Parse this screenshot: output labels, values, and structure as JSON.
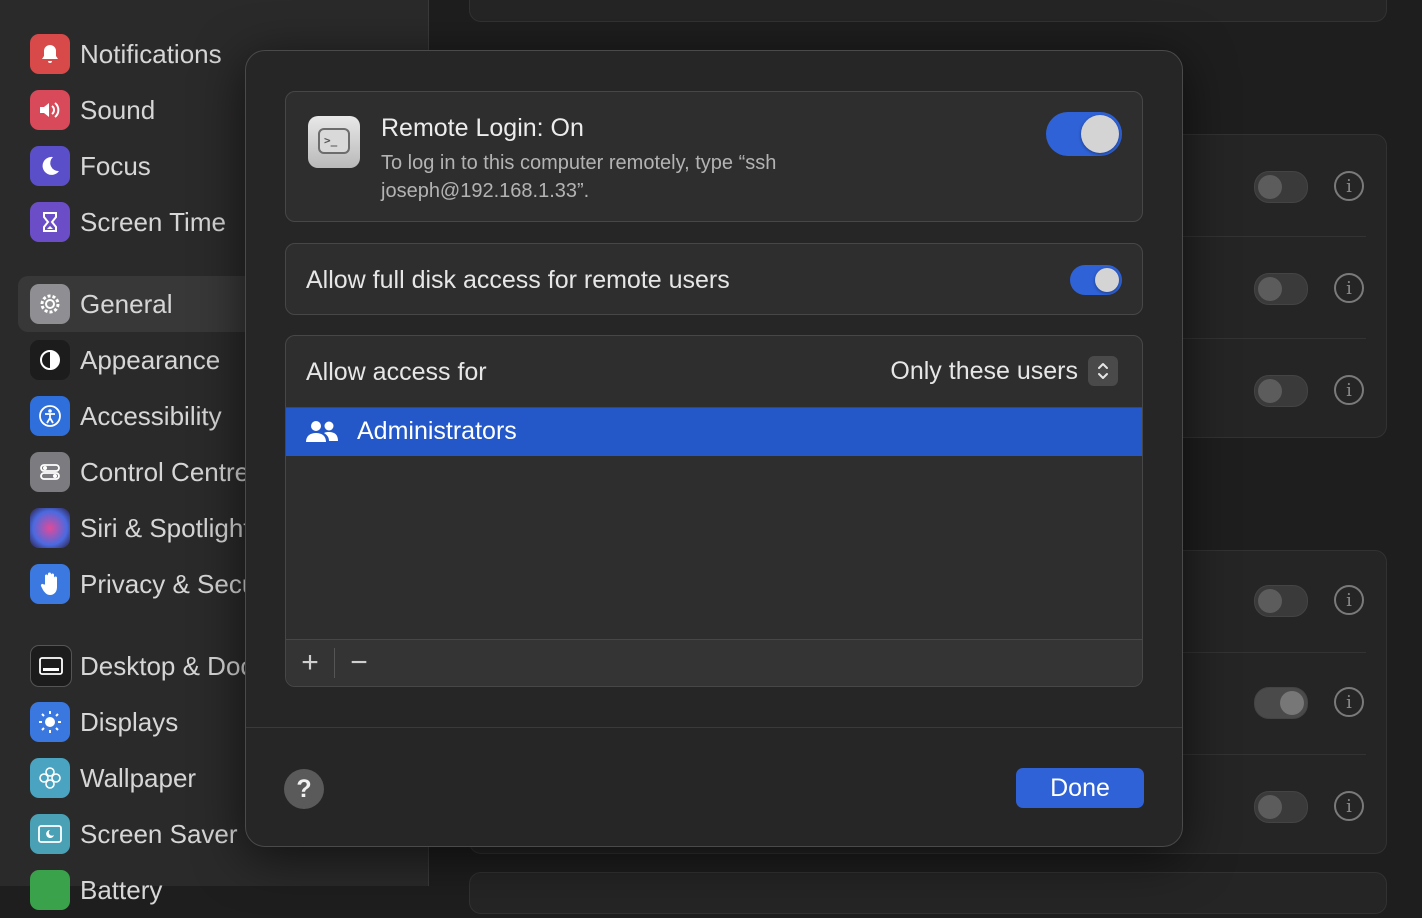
{
  "sidebar": {
    "items": [
      {
        "label": "Notifications",
        "icon": "bell-icon",
        "color": "#d84a4a"
      },
      {
        "label": "Sound",
        "icon": "speaker-icon",
        "color": "#d84a5a"
      },
      {
        "label": "Focus",
        "icon": "moon-icon",
        "color": "#5b4fc9"
      },
      {
        "label": "Screen Time",
        "icon": "hourglass-icon",
        "color": "#6b4ec7"
      },
      {
        "label": "General",
        "icon": "gear-icon",
        "color": "#8e8e93"
      },
      {
        "label": "Appearance",
        "icon": "appearance-icon",
        "color": "#1c1c1c"
      },
      {
        "label": "Accessibility",
        "icon": "accessibility-icon",
        "color": "#2f6fdc"
      },
      {
        "label": "Control Centre",
        "icon": "control-centre-icon",
        "color": "#7c7c80"
      },
      {
        "label": "Siri & Spotlight",
        "icon": "siri-icon",
        "color": "#3a2a55"
      },
      {
        "label": "Privacy & Security",
        "icon": "hand-icon",
        "color": "#3b78e0"
      },
      {
        "label": "Desktop & Dock",
        "icon": "dock-icon",
        "color": "#1c1c1c"
      },
      {
        "label": "Displays",
        "icon": "sun-icon",
        "color": "#3a78e0"
      },
      {
        "label": "Wallpaper",
        "icon": "flower-icon",
        "color": "#4aa3c0"
      },
      {
        "label": "Screen Saver",
        "icon": "screensaver-icon",
        "color": "#4aa0b5"
      },
      {
        "label": "Battery",
        "icon": "battery-icon",
        "color": "#3aa24a"
      }
    ],
    "selected": "General"
  },
  "background": {
    "toggles_top_card": [
      false,
      false,
      false
    ],
    "toggles_bottom_card": [
      false,
      true,
      false
    ]
  },
  "dialog": {
    "remote_login": {
      "title": "Remote Login: On",
      "description": "To log in to this computer remotely, type “ssh joseph@192.168.1.33”.",
      "enabled": true
    },
    "full_disk_access": {
      "label": "Allow full disk access for remote users",
      "enabled": true
    },
    "access": {
      "label": "Allow access for",
      "value": "Only these users",
      "users": [
        "Administrators"
      ],
      "add_label": "+",
      "remove_label": "−"
    },
    "help_label": "?",
    "done_label": "Done"
  },
  "colors": {
    "accent": "#2f62d7",
    "selection": "#2458c8"
  }
}
